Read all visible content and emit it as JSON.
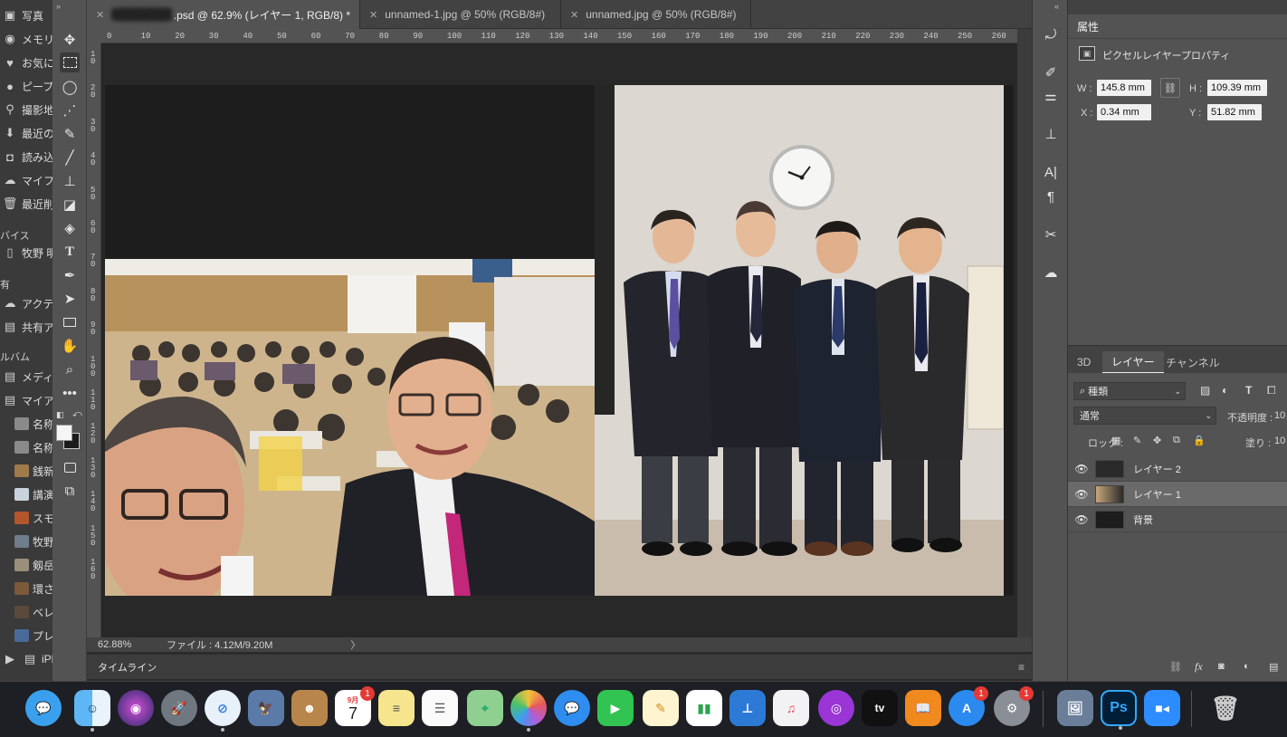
{
  "photos_sidebar": {
    "items": [
      {
        "icon": "photo-icon",
        "label": "写真"
      },
      {
        "icon": "memory-icon",
        "label": "メモリ"
      },
      {
        "icon": "heart-icon",
        "label": "お気に"
      },
      {
        "icon": "person-icon",
        "label": "ピープ"
      },
      {
        "icon": "pin-icon",
        "label": "撮影地"
      },
      {
        "icon": "import-icon",
        "label": "最近の"
      },
      {
        "icon": "camera-icon",
        "label": "読み込"
      },
      {
        "icon": "cloud-icon",
        "label": "マイフ"
      },
      {
        "icon": "trash-icon",
        "label": "最近削"
      }
    ],
    "section_devices": "バイス",
    "device_item": "牧野 明",
    "section_shared": "有",
    "shared_items": [
      "アクテ",
      "共有ア"
    ],
    "section_albums": "ルバム",
    "album_items": [
      "メディ",
      "マイア"
    ],
    "my_albums": [
      "名称",
      "名称",
      "銭新",
      "講演",
      "スモ",
      "牧野",
      "剱岳",
      "環さ",
      "ベレ",
      "プレ"
    ],
    "iphone_item": "iPh"
  },
  "tabs": [
    {
      "label": ".psd @ 62.9% (レイヤー 1, RGB/8) *",
      "active": true
    },
    {
      "label": "unnamed-1.jpg @ 50% (RGB/8#)",
      "active": false
    },
    {
      "label": "unnamed.jpg @ 50% (RGB/8#)",
      "active": false
    }
  ],
  "ruler": {
    "h_ticks": [
      "0",
      "10",
      "20",
      "30",
      "40",
      "50",
      "60",
      "70",
      "80",
      "90",
      "100",
      "110",
      "120",
      "130",
      "140",
      "150",
      "160",
      "170",
      "180",
      "190",
      "200",
      "210",
      "220",
      "230",
      "240",
      "250",
      "260"
    ],
    "v_ticks": [
      "1 0",
      "2 0",
      "3 0",
      "4 0",
      "5 0",
      "6 0",
      "7 0",
      "8 0",
      "9 0",
      "1 0 0",
      "1 1 0",
      "1 2 0",
      "1 3 0",
      "1 4 0",
      "1 5 0",
      "1 6 0"
    ]
  },
  "status": {
    "zoom": "62.88%",
    "file": "ファイル : 4.12M/9.20M",
    "arrow": "〉"
  },
  "timeline": {
    "label": "タイムライン",
    "menu": "≡"
  },
  "properties": {
    "tab": "属性",
    "subtitle": "ピクセルレイヤープロパティ",
    "w_label": "W :",
    "w_value": "145.8 mm",
    "h_label": "H :",
    "h_value": "109.39 mm",
    "x_label": "X :",
    "x_value": "0.34 mm",
    "y_label": "Y :",
    "y_value": "51.82 mm"
  },
  "layers_panel": {
    "tabs": [
      "3D",
      "レイヤー",
      "チャンネル"
    ],
    "filter_label": "種類",
    "blend_mode": "通常",
    "opacity_label": "不透明度 :",
    "opacity_value": "10",
    "lock_label": "ロック :",
    "fill_label": "塗り :",
    "fill_value": "10",
    "layers": [
      {
        "name": "レイヤー 2",
        "selected": false
      },
      {
        "name": "レイヤー 1",
        "selected": true
      },
      {
        "name": "背景",
        "selected": false
      }
    ]
  },
  "dock": {
    "calendar_month": "9月",
    "calendar_day": "7",
    "calendar_badge": "1",
    "appstore_badge": "1",
    "settings_badge": "1",
    "tv_label": "tv",
    "ps_label": "Ps"
  },
  "colors": {
    "accent": "#31a8ff",
    "panel": "#535353",
    "badge": "#e53935"
  }
}
